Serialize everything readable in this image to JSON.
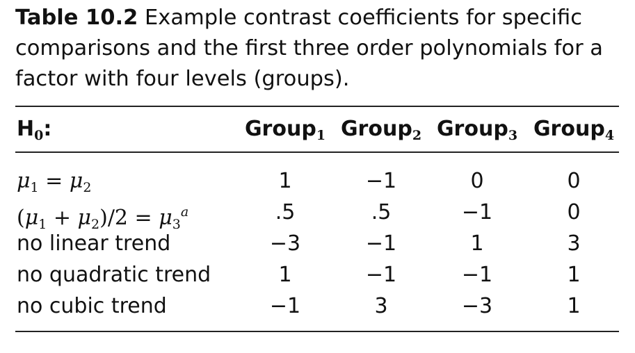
{
  "caption": {
    "label": "Table 10.2",
    "text": "Example contrast coefficients for specific comparisons and the first three order polynomials for a factor with four levels (groups)."
  },
  "table": {
    "header": {
      "h0_main": "H",
      "h0_sub": "0",
      "h0_suffix": ":",
      "groups": [
        {
          "main": "Group",
          "sub": "1"
        },
        {
          "main": "Group",
          "sub": "2"
        },
        {
          "main": "Group",
          "sub": "3"
        },
        {
          "main": "Group",
          "sub": "4"
        }
      ]
    },
    "rows": [
      {
        "math": true,
        "parts": {
          "mu_a": "μ",
          "sub_a": "1",
          "op": " = ",
          "mu_b": "μ",
          "sub_b": "2"
        },
        "values": [
          "1",
          "−1",
          "0",
          "0"
        ]
      },
      {
        "math": true,
        "parts": {
          "open": "(",
          "mu_a": "μ",
          "sub_a": "1",
          "plus": " + ",
          "mu_b": "μ",
          "sub_b": "2",
          "close": ")/2 = ",
          "mu_c": "μ",
          "sub_c": "3",
          "sup": "a"
        },
        "values": [
          ".5",
          ".5",
          "−1",
          "0"
        ]
      },
      {
        "label": "no linear trend",
        "values": [
          "−3",
          "−1",
          "1",
          "3"
        ]
      },
      {
        "label": "no quadratic trend",
        "values": [
          "1",
          "−1",
          "−1",
          "1"
        ]
      },
      {
        "label": "no cubic trend",
        "values": [
          "−1",
          "3",
          "−3",
          "1"
        ]
      }
    ]
  }
}
